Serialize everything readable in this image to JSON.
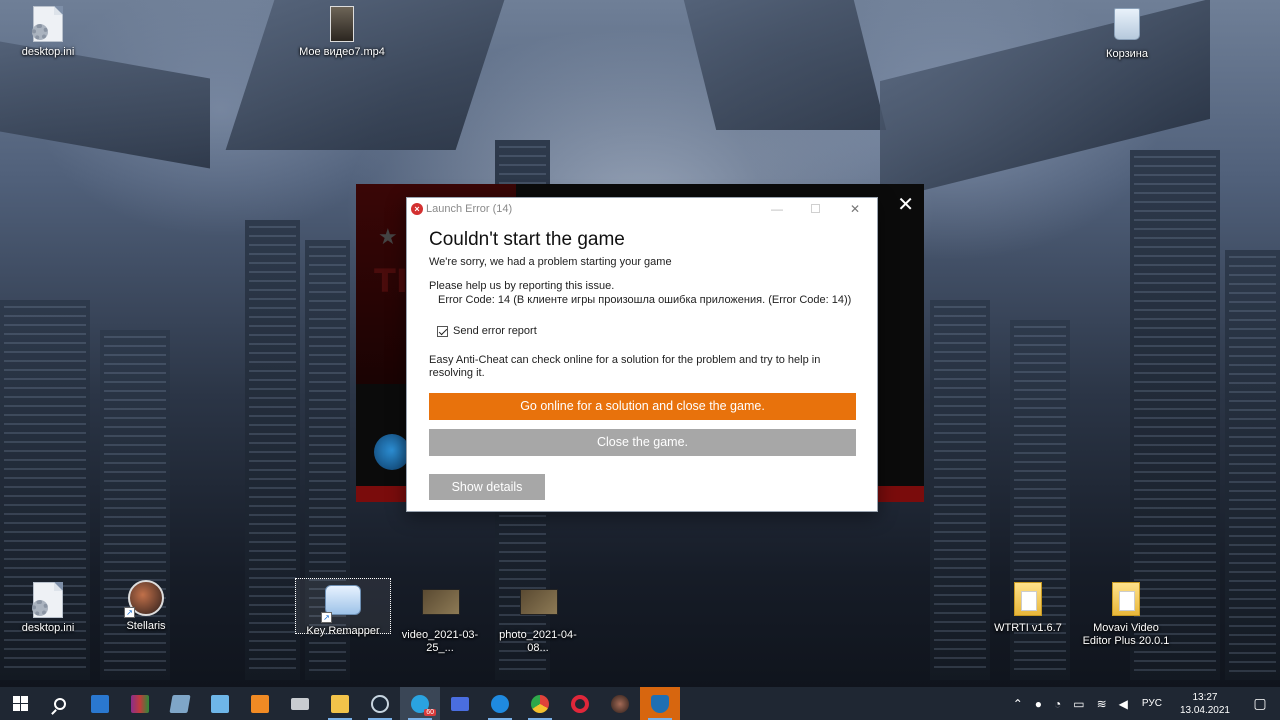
{
  "desktop": {
    "icons": {
      "desktop_ini_top": "desktop.ini",
      "video_mp4": "Мое видео7.mp4",
      "recycle_bin": "Корзина",
      "desktop_ini_bottom": "desktop.ini",
      "stellaris": "Stellaris",
      "key_remapper": "Key Remapper",
      "video_2021": "video_2021-03-25_...",
      "photo_2021": "photo_2021-04-08...",
      "wtrti": "WTRTI v1.6.7",
      "movavi": "Movavi Video Editor Plus 20.0.1"
    }
  },
  "launcher": {
    "close_glyph": "✕",
    "logo_text": "TI"
  },
  "dialog": {
    "title": "Launch Error (14)",
    "titlebar": {
      "minimize": "—",
      "close": "✕"
    },
    "headline": "Couldn't start the game",
    "subline": "We're sorry, we had a problem starting your game",
    "help": "Please help us by reporting this issue.",
    "error_code": "Error Code: 14 (В клиенте игры произошла ошибка приложения. (Error Code: 14))",
    "send_report_label": "Send error report",
    "send_report_checked": true,
    "eac_note": "Easy Anti-Cheat can check online for a solution for the problem and try to help in resolving it.",
    "buttons": {
      "online": "Go online for a solution and close the game.",
      "close": "Close the game.",
      "details": "Show details"
    },
    "colors": {
      "accent": "#e8720c",
      "secondary": "#a7a7a7"
    }
  },
  "taskbar": {
    "telegram_badge": "60",
    "tray": {
      "language": "РУС",
      "time": "13:27",
      "date": "13.04.2021"
    }
  }
}
